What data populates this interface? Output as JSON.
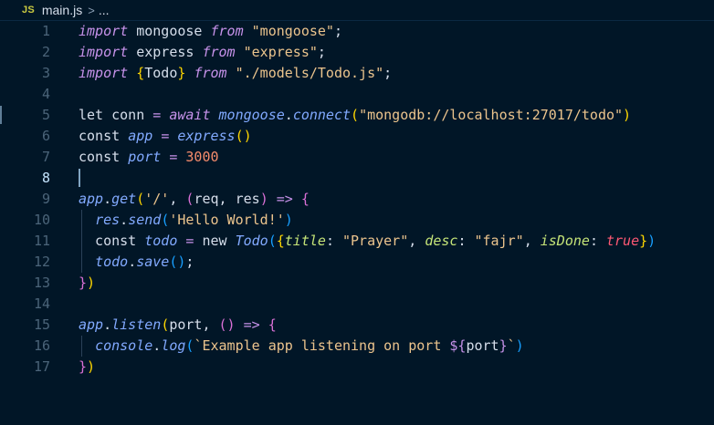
{
  "breadcrumb": {
    "lang_badge": "JS",
    "file": "main.js",
    "separator": ">",
    "ellipsis": "..."
  },
  "editor": {
    "active_line": 8,
    "lines": [
      {
        "n": "1",
        "tokens": [
          [
            "kw",
            "import"
          ],
          [
            "plain",
            " mongoose "
          ],
          [
            "kw",
            "from"
          ],
          [
            "plain",
            " "
          ],
          [
            "str",
            "\"mongoose\""
          ],
          [
            "plain",
            ";"
          ]
        ]
      },
      {
        "n": "2",
        "tokens": [
          [
            "kw",
            "import"
          ],
          [
            "plain",
            " express "
          ],
          [
            "kw",
            "from"
          ],
          [
            "plain",
            " "
          ],
          [
            "str",
            "\"express\""
          ],
          [
            "plain",
            ";"
          ]
        ]
      },
      {
        "n": "3",
        "tokens": [
          [
            "kw",
            "import"
          ],
          [
            "plain",
            " "
          ],
          [
            "p1",
            "{"
          ],
          [
            "plain",
            "Todo"
          ],
          [
            "p1",
            "}"
          ],
          [
            "plain",
            " "
          ],
          [
            "kw",
            "from"
          ],
          [
            "plain",
            " "
          ],
          [
            "str",
            "\"./models/Todo.js\""
          ],
          [
            "plain",
            ";"
          ]
        ]
      },
      {
        "n": "4",
        "tokens": []
      },
      {
        "n": "5",
        "tokens": [
          [
            "plain",
            "let conn "
          ],
          [
            "op",
            "="
          ],
          [
            "plain",
            " "
          ],
          [
            "kw",
            "await"
          ],
          [
            "plain",
            " "
          ],
          [
            "fn",
            "mongoose"
          ],
          [
            "plain",
            "."
          ],
          [
            "fn",
            "connect"
          ],
          [
            "p1",
            "("
          ],
          [
            "str",
            "\"mongodb://localhost:27017/todo\""
          ],
          [
            "p1",
            ")"
          ]
        ]
      },
      {
        "n": "6",
        "tokens": [
          [
            "plain",
            "const "
          ],
          [
            "fn",
            "app"
          ],
          [
            "plain",
            " "
          ],
          [
            "op",
            "="
          ],
          [
            "plain",
            " "
          ],
          [
            "fn",
            "express"
          ],
          [
            "p1",
            "()"
          ]
        ]
      },
      {
        "n": "7",
        "tokens": [
          [
            "plain",
            "const "
          ],
          [
            "fn",
            "port"
          ],
          [
            "plain",
            " "
          ],
          [
            "op",
            "="
          ],
          [
            "plain",
            " "
          ],
          [
            "num",
            "3000"
          ]
        ]
      },
      {
        "n": "8",
        "tokens": []
      },
      {
        "n": "9",
        "tokens": [
          [
            "fn",
            "app"
          ],
          [
            "plain",
            "."
          ],
          [
            "fn",
            "get"
          ],
          [
            "p1",
            "("
          ],
          [
            "str",
            "'/'"
          ],
          [
            "plain",
            ", "
          ],
          [
            "p2",
            "("
          ],
          [
            "plain",
            "req, res"
          ],
          [
            "p2",
            ")"
          ],
          [
            "plain",
            " "
          ],
          [
            "op",
            "=>"
          ],
          [
            "plain",
            " "
          ],
          [
            "p2",
            "{"
          ]
        ]
      },
      {
        "n": "10",
        "tokens": [
          [
            "plain",
            "  "
          ],
          [
            "fn",
            "res"
          ],
          [
            "plain",
            "."
          ],
          [
            "fn",
            "send"
          ],
          [
            "p3",
            "("
          ],
          [
            "str",
            "'Hello World!'"
          ],
          [
            "p3",
            ")"
          ]
        ]
      },
      {
        "n": "11",
        "tokens": [
          [
            "plain",
            "  const "
          ],
          [
            "fn",
            "todo"
          ],
          [
            "plain",
            " "
          ],
          [
            "op",
            "="
          ],
          [
            "plain",
            " new "
          ],
          [
            "fn",
            "Todo"
          ],
          [
            "p3",
            "("
          ],
          [
            "p1",
            "{"
          ],
          [
            "key",
            "title"
          ],
          [
            "plain",
            ": "
          ],
          [
            "str",
            "\"Prayer\""
          ],
          [
            "plain",
            ", "
          ],
          [
            "key",
            "desc"
          ],
          [
            "plain",
            ": "
          ],
          [
            "str",
            "\"fajr\""
          ],
          [
            "plain",
            ", "
          ],
          [
            "key",
            "isDone"
          ],
          [
            "plain",
            ": "
          ],
          [
            "bool",
            "true"
          ],
          [
            "p1",
            "}"
          ],
          [
            "p3",
            ")"
          ]
        ]
      },
      {
        "n": "12",
        "tokens": [
          [
            "plain",
            "  "
          ],
          [
            "fn",
            "todo"
          ],
          [
            "plain",
            "."
          ],
          [
            "fn",
            "save"
          ],
          [
            "p3",
            "()"
          ],
          [
            "plain",
            ";"
          ]
        ]
      },
      {
        "n": "13",
        "tokens": [
          [
            "p2",
            "}"
          ],
          [
            "p1",
            ")"
          ]
        ]
      },
      {
        "n": "14",
        "tokens": []
      },
      {
        "n": "15",
        "tokens": [
          [
            "fn",
            "app"
          ],
          [
            "plain",
            "."
          ],
          [
            "fn",
            "listen"
          ],
          [
            "p1",
            "("
          ],
          [
            "plain",
            "port, "
          ],
          [
            "p2",
            "()"
          ],
          [
            "plain",
            " "
          ],
          [
            "op",
            "=>"
          ],
          [
            "plain",
            " "
          ],
          [
            "p2",
            "{"
          ]
        ]
      },
      {
        "n": "16",
        "tokens": [
          [
            "plain",
            "  "
          ],
          [
            "fn",
            "console"
          ],
          [
            "plain",
            "."
          ],
          [
            "fn",
            "log"
          ],
          [
            "p3",
            "("
          ],
          [
            "str",
            "`Example app listening on port "
          ],
          [
            "tpl",
            "${"
          ],
          [
            "plain",
            "port"
          ],
          [
            "tpl",
            "}"
          ],
          [
            "str",
            "`"
          ],
          [
            "p3",
            ")"
          ]
        ]
      },
      {
        "n": "17",
        "tokens": [
          [
            "p2",
            "}"
          ],
          [
            "p1",
            ")"
          ]
        ]
      }
    ]
  }
}
